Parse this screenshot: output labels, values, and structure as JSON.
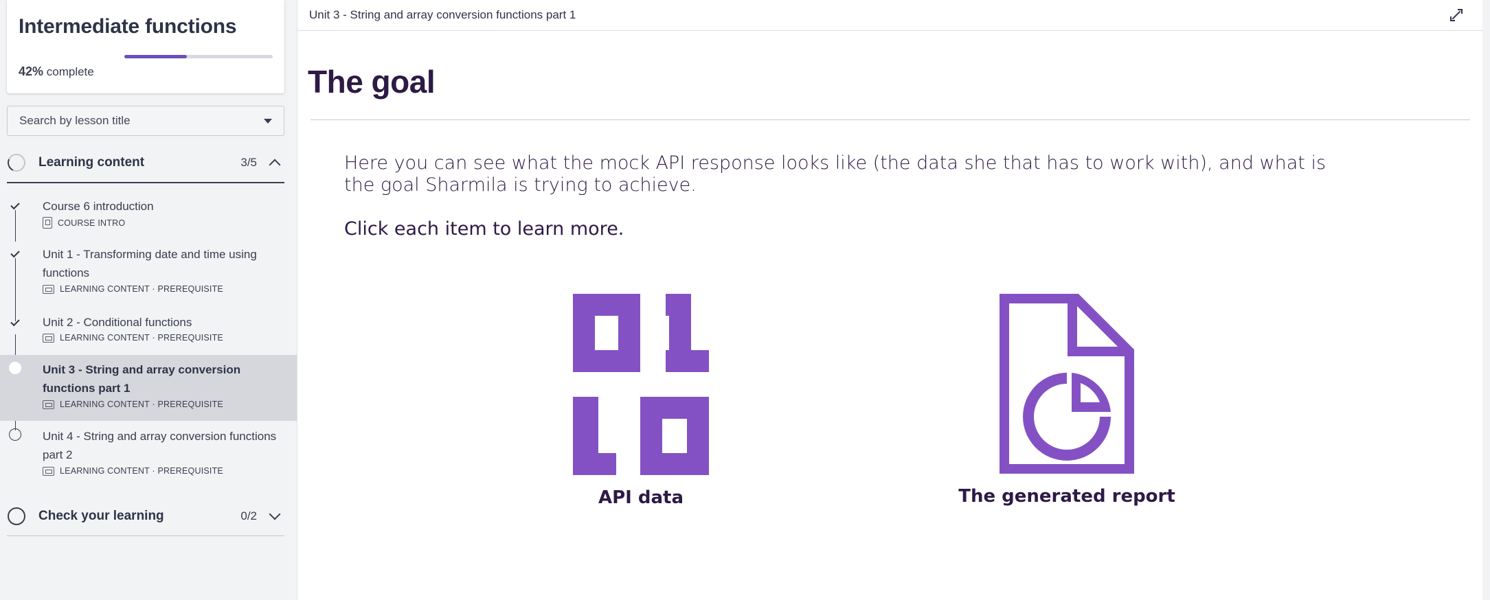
{
  "course": {
    "title": "Intermediate functions",
    "progress_pct": "42%",
    "progress_suffix": " complete",
    "progress_fraction": 0.42
  },
  "search": {
    "placeholder": "Search by lesson title"
  },
  "sections": [
    {
      "label": "Learning content",
      "count": "3/5",
      "state": "expanded"
    },
    {
      "label": "Check your learning",
      "count": "0/2",
      "state": "collapsed"
    }
  ],
  "lessons": [
    {
      "title": "Course 6 introduction",
      "meta": "COURSE INTRO",
      "status": "complete"
    },
    {
      "title": "Unit 1 - Transforming date and time using functions",
      "meta": "LEARNING CONTENT · PREREQUISITE",
      "status": "complete"
    },
    {
      "title": "Unit 2 - Conditional functions",
      "meta": "LEARNING CONTENT · PREREQUISITE",
      "status": "complete"
    },
    {
      "title": "Unit 3 - String and array conversion functions part 1",
      "meta": "LEARNING CONTENT · PREREQUISITE",
      "status": "current"
    },
    {
      "title": "Unit 4 - String and array conversion functions part 2",
      "meta": "LEARNING CONTENT · PREREQUISITE",
      "status": "not-started"
    }
  ],
  "main": {
    "breadcrumb": "Unit 3 - String and array conversion functions part 1",
    "heading": "The goal",
    "intro": "Here you can see what the mock API response looks like (the data she that has to work with), and what is the goal Sharmila is trying to achieve.",
    "click_prompt": "Click each item to learn more.",
    "items": [
      {
        "label": "API data",
        "icon": "binary-icon"
      },
      {
        "label": "The generated report",
        "icon": "report-document-icon"
      }
    ]
  },
  "colors": {
    "accent": "#8451c4",
    "heading": "#2d1a45",
    "active_row": "#d6d7dc"
  }
}
